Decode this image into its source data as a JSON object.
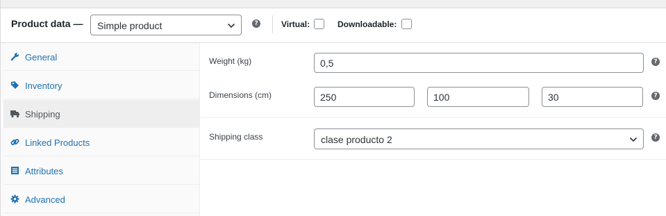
{
  "header": {
    "title": "Product data —",
    "product_type": "Simple product",
    "virtual_label": "Virtual:",
    "downloadable_label": "Downloadable:"
  },
  "tabs": [
    {
      "label": "General",
      "icon": "wrench-icon"
    },
    {
      "label": "Inventory",
      "icon": "tag-icon"
    },
    {
      "label": "Shipping",
      "icon": "truck-icon",
      "active": true
    },
    {
      "label": "Linked Products",
      "icon": "link-icon"
    },
    {
      "label": "Attributes",
      "icon": "list-icon"
    },
    {
      "label": "Advanced",
      "icon": "gear-icon"
    }
  ],
  "shipping": {
    "weight_label": "Weight (kg)",
    "weight_value": "0,5",
    "dimensions_label": "Dimensions (cm)",
    "length": "250",
    "width": "100",
    "height": "30",
    "class_label": "Shipping class",
    "class_value": "clase producto 2"
  },
  "help_glyph": "?",
  "colors": {
    "link": "#2271b1",
    "active_tab_bg": "#eeeeee",
    "border": "#8c8f94"
  }
}
